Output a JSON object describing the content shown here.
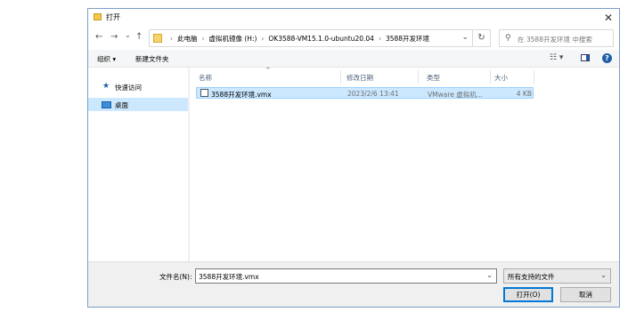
{
  "window": {
    "title": "打开"
  },
  "nav": {
    "back": "←",
    "forward": "→",
    "recent": "⌄",
    "up": "↑",
    "breadcrumbs": [
      "此电脑",
      "虚拟机镜像 (H:)",
      "OK3588-VM15.1.0-ubuntu20.04",
      "3588开发环境"
    ],
    "search_placeholder": "在 3588开发环境 中搜索"
  },
  "toolbar": {
    "organize": "组织 ▾",
    "new_folder": "新建文件夹"
  },
  "sidebar": {
    "items": [
      {
        "label": "快速访问",
        "icon": "pin-icon"
      },
      {
        "label": "桌面",
        "icon": "desktop-icon",
        "selected": true
      }
    ]
  },
  "columns": {
    "name": "名称",
    "modified": "修改日期",
    "type": "类型",
    "size": "大小"
  },
  "files": [
    {
      "name": "3588开发环境.vmx",
      "modified": "2023/2/6 13:41",
      "type": "VMware 虚拟机...",
      "size": "4 KB"
    }
  ],
  "bottom": {
    "filename_label": "文件名(N):",
    "filename_value": "3588开发环境.vmx",
    "filter_value": "所有支持的文件",
    "open_label": "打开(O)",
    "cancel_label": "取消"
  },
  "colors": {
    "selection": "#cce8ff",
    "accent": "#0078d7"
  }
}
